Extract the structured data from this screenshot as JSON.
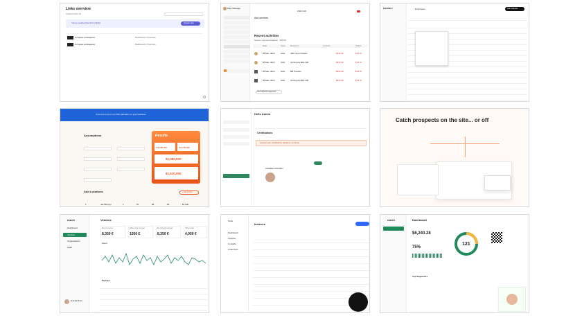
{
  "tile1": {
    "title": "Links overview",
    "subtitle": "Inspired links (3)",
    "banner_text": "You've reached the limit of links.",
    "banner_button": "Upgrade plan",
    "rows": [
      {
        "name": "Compare workspaces",
        "col2": "Dashboard / Overview"
      },
      {
        "name": "Compare workspaces",
        "col2": "Dashboard / Overview"
      }
    ]
  },
  "tile2": {
    "user": "Riley Manager",
    "section_title": "Add services",
    "recent_title": "Recent activities",
    "recent_sub": "Source: payment balance · 000.00",
    "columns": [
      "Date",
      "Type",
      "Recipient",
      "Amount",
      "Tax amount",
      "Total",
      "Status"
    ],
    "rows": [
      {
        "date": "05 Mar, 2024",
        "type": "ACH",
        "recipient": "ABC store transfer",
        "amount": "$432.29",
        "status": "$44.70"
      },
      {
        "date": "05 Mar, 2024",
        "type": "ACH",
        "recipient": "Joining fee $12,400",
        "amount": "$432.29",
        "status": "$44.70"
      },
      {
        "date": "05 Mar, 2024",
        "type": "ACH",
        "recipient": "Bill Transfer",
        "amount": "$432.29",
        "status": "$44.70"
      },
      {
        "date": "05 Mar, 2024",
        "type": "ACH",
        "recipient": "Joining fee $12,400",
        "amount": "$432.29",
        "status": "$44.70"
      }
    ],
    "footer_button": "View all activity statements",
    "currency_label": "USD 0.00"
  },
  "tile3": {
    "app": "SHARELY",
    "page": "Employees",
    "add_button": "Add employee",
    "rows": 14
  },
  "tile4": {
    "banner": "Find out more on our ROI calculator on your business",
    "assumptions_title": "Assumptions",
    "results_title": "Results",
    "result_values": [
      "$1,380,000",
      "$1,700,000",
      "$1,080,000",
      "$1,510,000"
    ],
    "locations_title": "Add Locations",
    "add_location_button": "+ Add location",
    "location_values": [
      "1",
      "Jan Berwyn",
      "1",
      "#1",
      "$0",
      "$0",
      "$1,500"
    ]
  },
  "tile5": {
    "greeting": "Hello Admin",
    "tabs": [
      "Overview",
      "Profile",
      "Certifications",
      "Settings"
    ],
    "sidebar": [
      "Home",
      "Recent Candidates",
      "Candidates",
      "Talent Management",
      "Leader Trust",
      "Account",
      "Profile",
      "Contact Information",
      "Certifications",
      "Preferences",
      "Notifications",
      "CE Credit Tracker",
      "Permissions"
    ],
    "warning": "Upload your certification details to continue",
    "warning_button": "Upload",
    "section": "Certifications",
    "profile_title": "Candidate Information"
  },
  "tile6": {
    "headline": "Catch prospects on the site... or off"
  },
  "tile7": {
    "app": "ranch",
    "page": "Vendors",
    "sidebar": [
      "Dashboard",
      "Vendors",
      "Organizations",
      "Audit"
    ],
    "stats": [
      {
        "label": "Direct revenue",
        "value": "8,350 €"
      },
      {
        "label": "Office Cost revenue",
        "value": "1050 €"
      },
      {
        "label": "Recurring Expenses",
        "value": "8,350 €"
      },
      {
        "label": "Office sales",
        "value": "4,050 €"
      }
    ],
    "chart_label": "Spent",
    "table_title": "Partners",
    "user_name": "Amanda Brown"
  },
  "tile8": {
    "app": "Tools",
    "page": "Invoices",
    "primary_button": "Create invoice",
    "sidebar": [
      "Dashboard",
      "Invoices",
      "Contacts",
      "Customers"
    ],
    "rows": 12
  },
  "tile9": {
    "app": "ranch",
    "page": "Dashboard",
    "balance": "$6,240.28",
    "score_percent": "75%",
    "gauge_value": "121",
    "section": "Top Supporters",
    "badge": "Hire 1st Collaborator"
  }
}
